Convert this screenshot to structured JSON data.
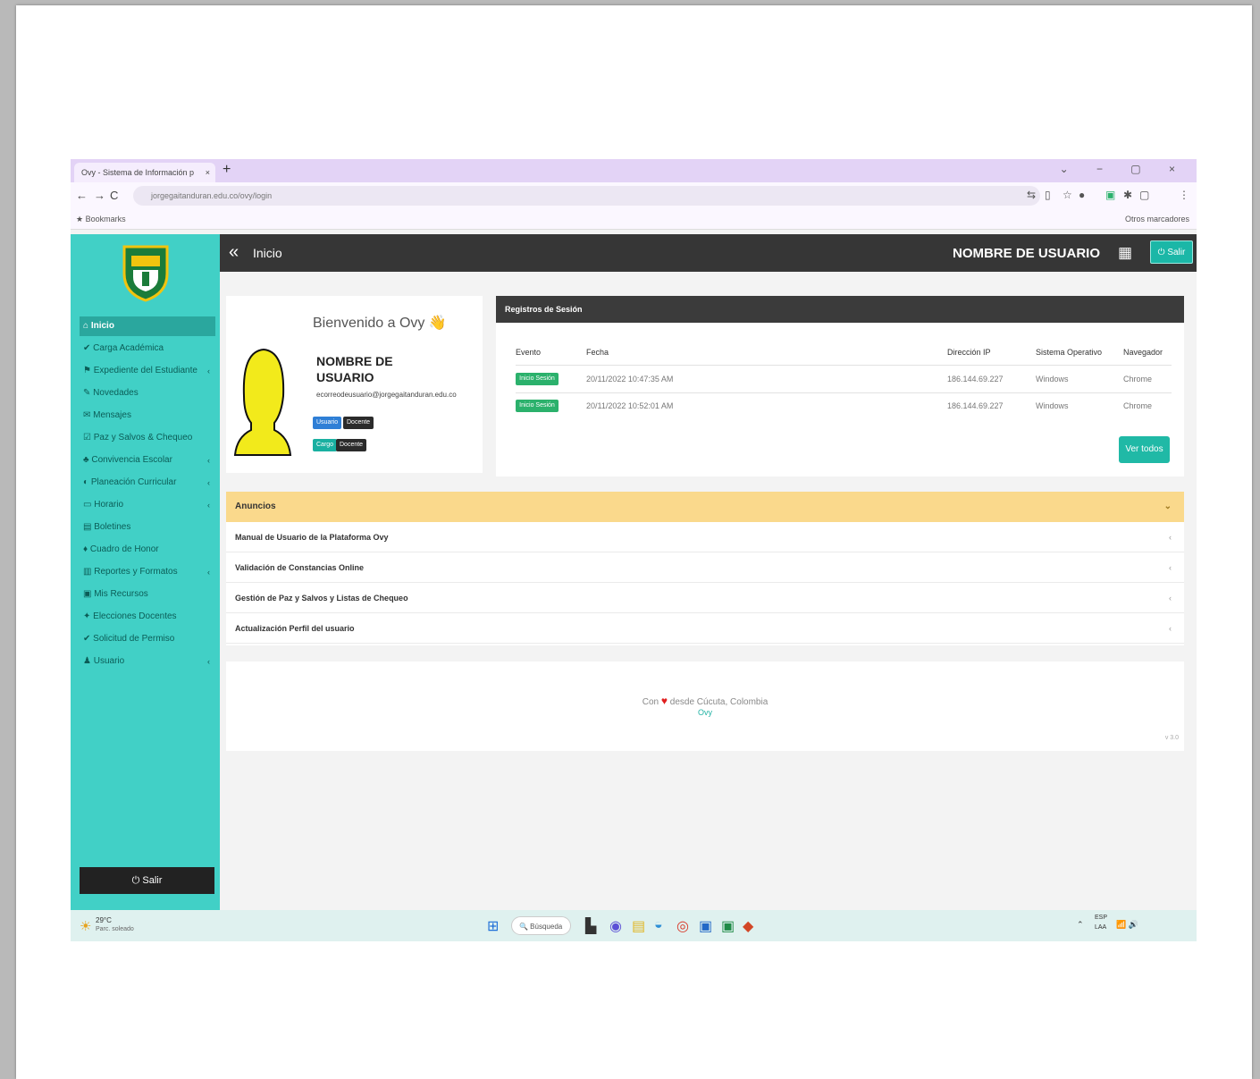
{
  "browser": {
    "tab_title": "Ovy - Sistema de Información p",
    "tab_close": "×",
    "new_tab": "+",
    "window_controls": "⌄ − ▢ ×",
    "address": "jorgegaitanduran.edu.co/ovy/login",
    "bookmark_left": "★ Bookmarks",
    "bookmark_right": "Otros marcadores"
  },
  "sidebar": {
    "items": [
      {
        "label": "⌂ Inicio"
      },
      {
        "label": "✔ Carga Académica"
      },
      {
        "label": "⚑ Expediente del Estudiante",
        "chev": "‹"
      },
      {
        "label": "✎ Novedades"
      },
      {
        "label": "✉ Mensajes"
      },
      {
        "label": "☑ Paz y Salvos & Chequeo"
      },
      {
        "label": "♣ Convivencia Escolar",
        "chev": "‹"
      },
      {
        "label": "◐ Planeación Curricular",
        "chev": "‹"
      },
      {
        "label": "▭ Horario",
        "chev": "‹"
      },
      {
        "label": "▤ Boletines"
      },
      {
        "label": "♦ Cuadro de Honor"
      },
      {
        "label": "▥ Reportes y Formatos",
        "chev": "‹"
      },
      {
        "label": "▣ Mis Recursos"
      },
      {
        "label": "✦ Elecciones Docentes"
      },
      {
        "label": "✔ Solicitud de Permiso"
      },
      {
        "label": "♟ Usuario",
        "chev": "‹"
      }
    ],
    "logout": "⏻ Salir"
  },
  "topbar": {
    "collapse_glyph": "«",
    "title": "Inicio",
    "username": "NOMBRE DE USUARIO",
    "apps_glyph": "▦",
    "logout": "⏻ Salir"
  },
  "welcome": {
    "title": "Bienvenido a Ovy 👋",
    "name": "NOMBRE DE USUARIO",
    "email": "ecorreodeusuario@jorgegaitanduran.edu.co",
    "badge_role_a": "Usuario",
    "badge_role_b": "Docente",
    "badge_type_a": "Cargo",
    "badge_type_b": "Docente"
  },
  "sessions": {
    "title": "Registros de Sesión",
    "columns": [
      "Evento",
      "Fecha",
      "Dirección IP",
      "Sistema Operativo",
      "Navegador"
    ],
    "rows": [
      {
        "event": "Inicio Sesión",
        "date": "20/11/2022 10:47:35 AM",
        "ip": "186.144.69.227",
        "os": "Windows",
        "browser": "Chrome"
      },
      {
        "event": "Inicio Sesión",
        "date": "20/11/2022 10:52:01 AM",
        "ip": "186.144.69.227",
        "os": "Windows",
        "browser": "Chrome"
      }
    ],
    "see_all": "Ver todos"
  },
  "announcements": {
    "title": "Anuncios",
    "chev": "⌄",
    "items": [
      "Manual de Usuario de la Plataforma Ovy",
      "Validación de Constancias Online",
      "Gestión de Paz y Salvos y Listas de Chequeo",
      "Actualización Perfil del usuario"
    ],
    "item_chev": "‹"
  },
  "footer": {
    "prefix": "Con",
    "heart": "♥",
    "suffix": "desde Cúcuta, Colombia",
    "link": "Ovy",
    "version": "v 3.0"
  },
  "taskbar": {
    "weather_temp": "29°C",
    "weather_desc": "Parc. soleado",
    "search": "🔍 Búsqueda",
    "tray_lang_a": "ESP",
    "tray_lang_b": "LAA",
    "tray_icons": "⌃",
    "tray_net": "📶 🔊"
  },
  "colors": {
    "sidebar": "#41d0c6",
    "topbar": "#363636",
    "announce": "#fad98c",
    "accent": "#20b9a6"
  }
}
